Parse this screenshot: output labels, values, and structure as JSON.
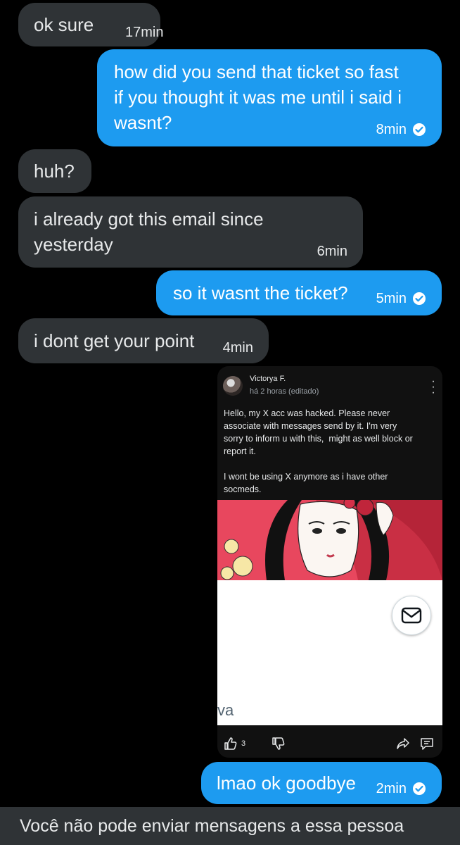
{
  "messages": [
    {
      "text": "ok sure",
      "time": "17min"
    },
    {
      "text": "how did you send that ticket so fast\nif you thought it was me until i said i\nwasnt?",
      "time": "8min"
    },
    {
      "text": "huh?"
    },
    {
      "text": "i already got this email since\nyesterday",
      "time": "6min"
    },
    {
      "text": "so it wasnt the ticket?",
      "time": "5min"
    },
    {
      "text": "i dont get your point",
      "time": "4min"
    },
    {
      "text": "lmao ok goodbye",
      "time": "2min"
    }
  ],
  "attachment": {
    "author": "Victorya F.",
    "meta": "há 2 horas (editado)",
    "body": "Hello, my X acc was hacked. Please never\nassociate with messages send by it. I'm very\nsorry to inform u with this,  might as well block or\nreport it.\n\nI wont be using X anymore as i have other\nsocmeds.",
    "partial_text": "va",
    "like_count": "3"
  },
  "footer": {
    "notice": "Você não pode enviar mensagens a essa pessoa"
  },
  "colors": {
    "outgoing": "#1d9bf0",
    "incoming": "#2f3336",
    "background": "#000000"
  }
}
